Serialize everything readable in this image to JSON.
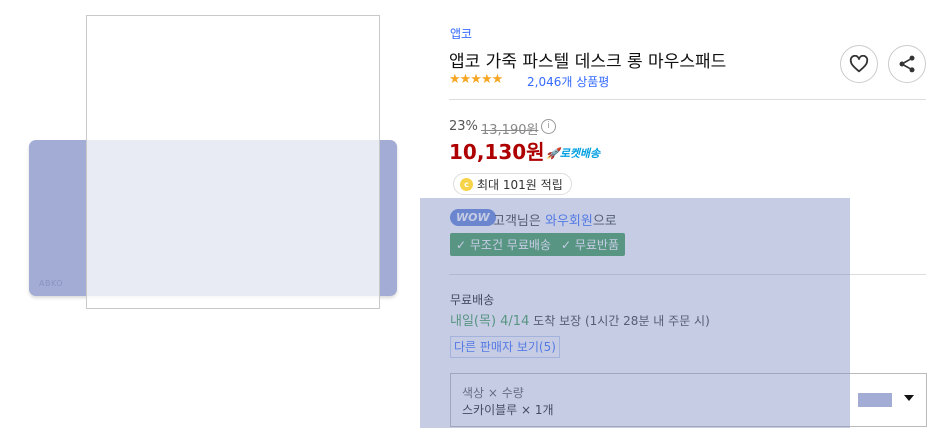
{
  "product": {
    "brand": "앱코",
    "title": "앱코 가죽 파스텔 데스크 롱 마우스패드",
    "stars": "★★★★★",
    "review_count": "2,046개 상품평",
    "rating": 5,
    "image_brand_mark": "ABKO"
  },
  "price": {
    "discount": "23%",
    "original": "13,190원",
    "info_glyph": "i",
    "sale": "10,130원",
    "rocket_label": "🚀로켓배송"
  },
  "points": {
    "coin_glyph": "c",
    "text": "최대 101원 적립"
  },
  "wow": {
    "badge": "WOW",
    "text_prefix": "고객님은 ",
    "text_highlight": "와우회원",
    "text_suffix": "으로",
    "benefit_1": "✓ 무조건 무료배송",
    "benefit_2": "✓ 무료반품"
  },
  "shipping": {
    "title": "무료배송",
    "date_highlight": "내일(목) 4/14",
    "date_rest": " 도착 보장 (1시간 28분 내 주문 시)",
    "other_sellers": "다른 판매자 보기(5)"
  },
  "option": {
    "label": "색상 × 수량",
    "value": "스카이블루 × 1개",
    "swatch_color": "#a3acd4"
  },
  "icons": {
    "heart": "heart-icon",
    "share": "share-icon"
  },
  "colors": {
    "accent_blue": "#346aff",
    "price_red": "#ae0000",
    "wow_green": "#3b9c4f"
  }
}
